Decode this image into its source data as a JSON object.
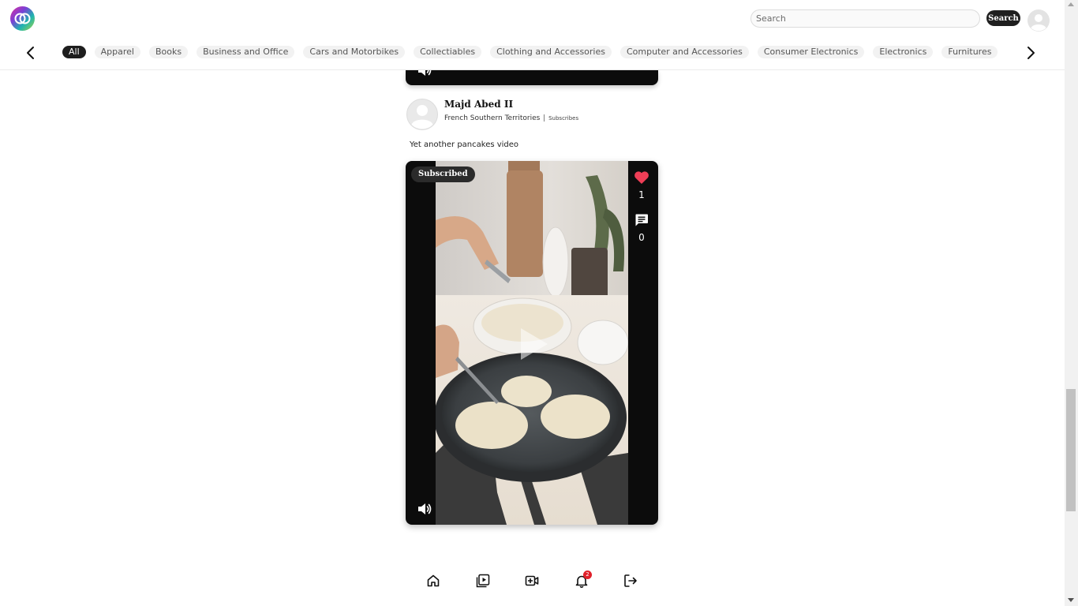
{
  "header": {
    "logo_icon": "intertwined-rings-logo",
    "search": {
      "placeholder": "Search",
      "value": ""
    },
    "search_button_label": "Search",
    "avatar_icon": "default-user-avatar"
  },
  "categories": {
    "items": [
      "All",
      "Apparel",
      "Books",
      "Business and Office",
      "Cars and Motorbikes",
      "Collectiables",
      "Clothing and Accessories",
      "Computer and Accessories",
      "Consumer Electronics",
      "Electronics",
      "Furnitures"
    ],
    "active_index": 0
  },
  "post": {
    "author": "Majd Abed II",
    "location": "French Southern Territories",
    "separator": "|",
    "subscribe_label": "Subscribes",
    "caption": "Yet another pancakes video",
    "video": {
      "badge": "Subscribed",
      "likes": "1",
      "comments": "0",
      "liked": true,
      "like_color": "#ee3e56"
    }
  },
  "bottom_nav": {
    "items": [
      "home-icon",
      "video-library-icon",
      "add-video-icon",
      "bell-icon",
      "logout-icon"
    ],
    "notification_count": "2"
  },
  "scroll": {
    "position_fraction": 0.82
  }
}
